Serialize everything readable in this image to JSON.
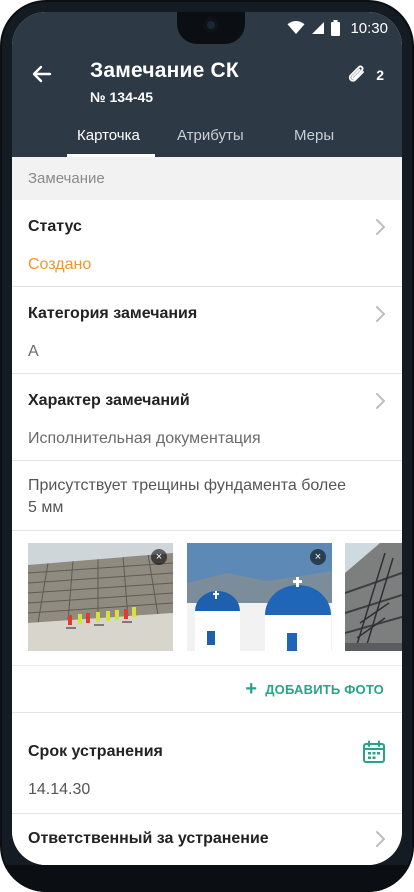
{
  "status_bar": {
    "time": "10:30"
  },
  "header": {
    "title": "Замечание СК",
    "subtitle": "№ 134-45",
    "attachments_count": "2",
    "tabs": [
      {
        "label": "Карточка",
        "active": true
      },
      {
        "label": "Атрибуты",
        "active": false
      },
      {
        "label": "Меры",
        "active": false
      }
    ]
  },
  "section": {
    "label": "Замечание"
  },
  "fields": {
    "status": {
      "label": "Статус",
      "value": "Создано"
    },
    "category": {
      "label": "Категория замечания",
      "value": "А"
    },
    "character": {
      "label": "Характер замечаний",
      "value": "Исполнительная документация"
    },
    "description": "Присутствует трещины фундамента более 5 мм",
    "deadline": {
      "label": "Срок устранения",
      "value": "14.14.30"
    },
    "responsible": {
      "label": "Ответственный за устранение"
    }
  },
  "photos": {
    "add_label": "ДОБАВИТЬ ФОТО",
    "close_glyph": "×"
  },
  "colors": {
    "header_bg": "#2d3944",
    "accent": "#26a38a",
    "status_orange": "#f0962e"
  }
}
